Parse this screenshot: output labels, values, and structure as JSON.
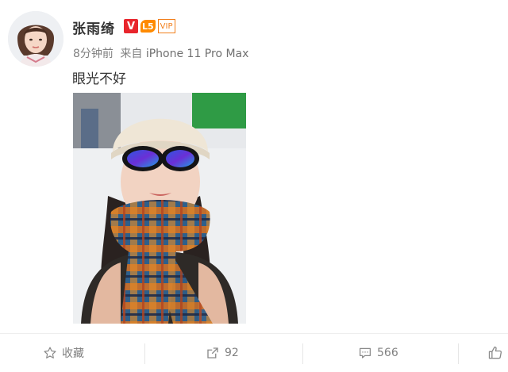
{
  "post": {
    "author": "张雨绮",
    "badges": {
      "verified": "V",
      "level": "L5",
      "vip": "VIP"
    },
    "time": "8分钟前",
    "source_prefix": "来自",
    "device": "iPhone 11 Pro Max",
    "text": "眼光不好"
  },
  "actions": {
    "favorite_label": "收藏",
    "repost_count": "92",
    "comment_count": "566"
  },
  "icons": [
    "star-icon",
    "share-icon",
    "comment-icon",
    "like-icon"
  ],
  "colors": {
    "accent": "#e8252c",
    "muted": "#808080",
    "vip": "#f27f1c"
  }
}
